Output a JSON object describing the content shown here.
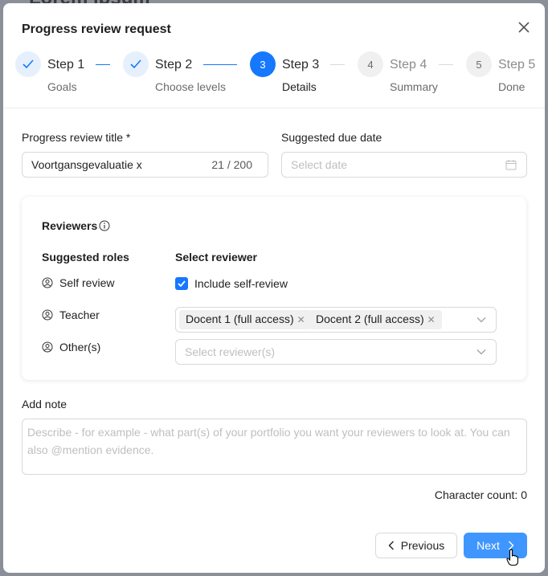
{
  "backdrop": {
    "title": "Lorem ipsum"
  },
  "modal": {
    "title": "Progress review request",
    "steps": [
      {
        "label": "Step 1",
        "sub": "Goals",
        "state": "done",
        "number": ""
      },
      {
        "label": "Step 2",
        "sub": "Choose levels",
        "state": "done",
        "number": ""
      },
      {
        "label": "Step 3",
        "sub": "Details",
        "state": "active",
        "number": "3"
      },
      {
        "label": "Step 4",
        "sub": "Summary",
        "state": "pending",
        "number": "4"
      },
      {
        "label": "Step 5",
        "sub": "Done",
        "state": "pending",
        "number": "5"
      }
    ],
    "form": {
      "title_label": "Progress review title *",
      "title_value": "Voortgansgevaluatie x",
      "title_count": "21 / 200",
      "due_label": "Suggested due date",
      "due_placeholder": "Select date"
    },
    "reviewers": {
      "heading": "Reviewers",
      "col_roles": "Suggested roles",
      "col_select": "Select reviewer",
      "roles": [
        {
          "label": "Self review"
        },
        {
          "label": "Teacher"
        },
        {
          "label": "Other(s)"
        }
      ],
      "self_review_checkbox_label": "Include self-review",
      "self_review_checked": true,
      "teacher_tags": [
        "Docent 1 (full access)",
        "Docent 2 (full access)"
      ],
      "other_placeholder": "Select reviewer(s)"
    },
    "note": {
      "label": "Add note",
      "placeholder": "Describe - for example - what part(s) of your portfolio you want your reviewers to look at. You can also @mention evidence."
    },
    "char_count": "Character count: 0",
    "buttons": {
      "previous": "Previous",
      "next": "Next"
    }
  },
  "colors": {
    "accent": "#1677ff",
    "next_button": "#4096ff"
  }
}
